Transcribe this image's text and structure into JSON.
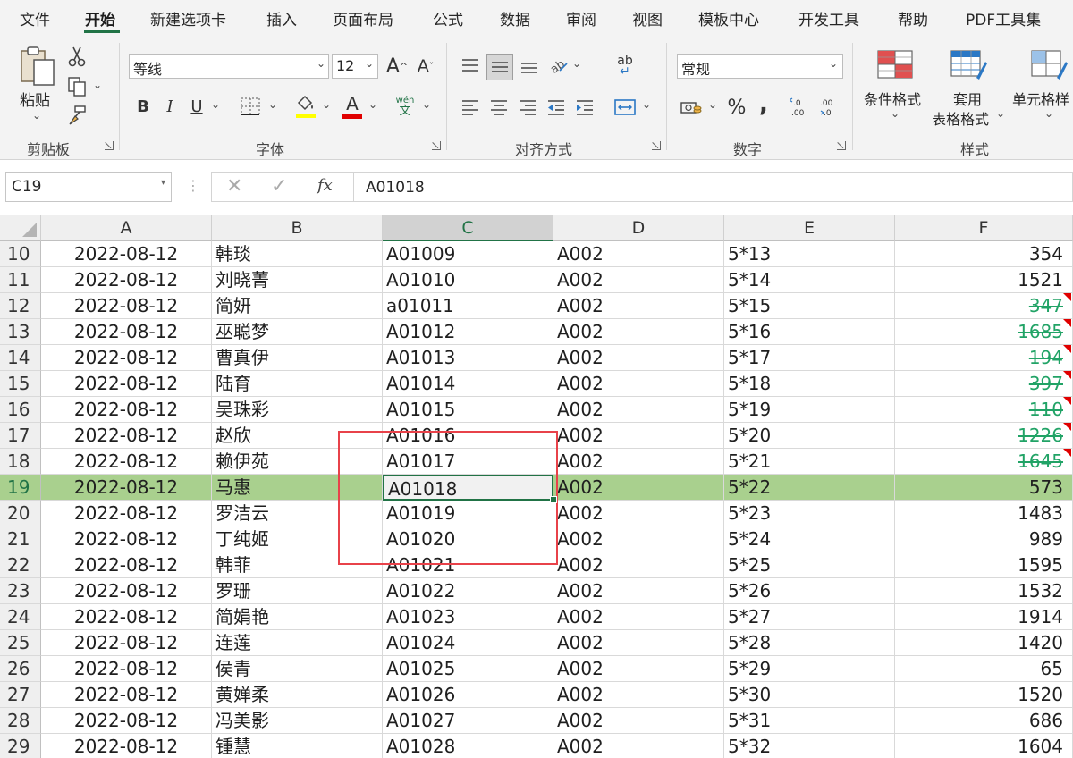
{
  "menu": {
    "items": [
      "文件",
      "开始",
      "新建选项卡",
      "插入",
      "页面布局",
      "公式",
      "数据",
      "审阅",
      "视图",
      "模板中心",
      "开发工具",
      "帮助",
      "PDF工具集"
    ],
    "active_index": 1
  },
  "ribbon": {
    "clipboard": {
      "paste_label": "粘贴",
      "group_label": "剪贴板"
    },
    "font": {
      "font_name": "等线",
      "font_size": "12",
      "bold": "B",
      "italic": "I",
      "underline": "U",
      "grow": "A",
      "shrink": "A",
      "phonetic_top": "wén",
      "phonetic_bottom": "文",
      "font_color_glyph": "A",
      "group_label": "字体"
    },
    "alignment": {
      "group_label": "对齐方式",
      "wrap_glyph": "ab"
    },
    "number": {
      "format": "常规",
      "percent": "%",
      "comma": ",",
      "group_label": "数字"
    },
    "styles": {
      "conditional": "条件格式",
      "table_line1": "套用",
      "table_line2": "表格格式",
      "cell": "单元格样",
      "group_label": "样式"
    }
  },
  "formula_bar": {
    "name_box": "C19",
    "fx": "fx",
    "value": "A01018"
  },
  "sheet": {
    "columns": [
      "A",
      "B",
      "C",
      "D",
      "E",
      "F"
    ],
    "selected_column": "C",
    "selected_row": 19,
    "rows": [
      {
        "n": "10",
        "a": "2022-08-12",
        "b": "韩琰",
        "c": "A01009",
        "d": "A002",
        "e": "5*13",
        "f": "354",
        "s": false
      },
      {
        "n": "11",
        "a": "2022-08-12",
        "b": "刘晓菁",
        "c": "A01010",
        "d": "A002",
        "e": "5*14",
        "f": "1521",
        "s": false
      },
      {
        "n": "12",
        "a": "2022-08-12",
        "b": "简妍",
        "c": "a01011",
        "d": "A002",
        "e": "5*15",
        "f": "347",
        "s": true
      },
      {
        "n": "13",
        "a": "2022-08-12",
        "b": "巫聪梦",
        "c": "A01012",
        "d": "A002",
        "e": "5*16",
        "f": "1685",
        "s": true
      },
      {
        "n": "14",
        "a": "2022-08-12",
        "b": "曹真伊",
        "c": "A01013",
        "d": "A002",
        "e": "5*17",
        "f": "194",
        "s": true
      },
      {
        "n": "15",
        "a": "2022-08-12",
        "b": "陆育",
        "c": "A01014",
        "d": "A002",
        "e": "5*18",
        "f": "397",
        "s": true
      },
      {
        "n": "16",
        "a": "2022-08-12",
        "b": "吴珠彩",
        "c": "A01015",
        "d": "A002",
        "e": "5*19",
        "f": "110",
        "s": true
      },
      {
        "n": "17",
        "a": "2022-08-12",
        "b": "赵欣",
        "c": "A01016",
        "d": "A002",
        "e": "5*20",
        "f": "1226",
        "s": true
      },
      {
        "n": "18",
        "a": "2022-08-12",
        "b": "赖伊苑",
        "c": "A01017",
        "d": "A002",
        "e": "5*21",
        "f": "1645",
        "s": true
      },
      {
        "n": "19",
        "a": "2022-08-12",
        "b": "马惠",
        "c": "A01018",
        "d": "A002",
        "e": "5*22",
        "f": "573",
        "s": false
      },
      {
        "n": "20",
        "a": "2022-08-12",
        "b": "罗洁云",
        "c": "A01019",
        "d": "A002",
        "e": "5*23",
        "f": "1483",
        "s": false
      },
      {
        "n": "21",
        "a": "2022-08-12",
        "b": "丁纯姬",
        "c": "A01020",
        "d": "A002",
        "e": "5*24",
        "f": "989",
        "s": false
      },
      {
        "n": "22",
        "a": "2022-08-12",
        "b": "韩菲",
        "c": "A01021",
        "d": "A002",
        "e": "5*25",
        "f": "1595",
        "s": false
      },
      {
        "n": "23",
        "a": "2022-08-12",
        "b": "罗珊",
        "c": "A01022",
        "d": "A002",
        "e": "5*26",
        "f": "1532",
        "s": false
      },
      {
        "n": "24",
        "a": "2022-08-12",
        "b": "简娟艳",
        "c": "A01023",
        "d": "A002",
        "e": "5*27",
        "f": "1914",
        "s": false
      },
      {
        "n": "25",
        "a": "2022-08-12",
        "b": "连莲",
        "c": "A01024",
        "d": "A002",
        "e": "5*28",
        "f": "1420",
        "s": false
      },
      {
        "n": "26",
        "a": "2022-08-12",
        "b": "侯青",
        "c": "A01025",
        "d": "A002",
        "e": "5*29",
        "f": "65",
        "s": false
      },
      {
        "n": "27",
        "a": "2022-08-12",
        "b": "黄婵柔",
        "c": "A01026",
        "d": "A002",
        "e": "5*30",
        "f": "1520",
        "s": false
      },
      {
        "n": "28",
        "a": "2022-08-12",
        "b": "冯美影",
        "c": "A01027",
        "d": "A002",
        "e": "5*31",
        "f": "686",
        "s": false
      },
      {
        "n": "29",
        "a": "2022-08-12",
        "b": "锺慧",
        "c": "A01028",
        "d": "A002",
        "e": "5*32",
        "f": "1604",
        "s": false
      }
    ]
  },
  "colors": {
    "accent": "#217346",
    "highlight_row": "#a9d08e",
    "strike_text": "#21a366",
    "comment_marker": "#e00000",
    "annotation_box": "#e8424a"
  }
}
